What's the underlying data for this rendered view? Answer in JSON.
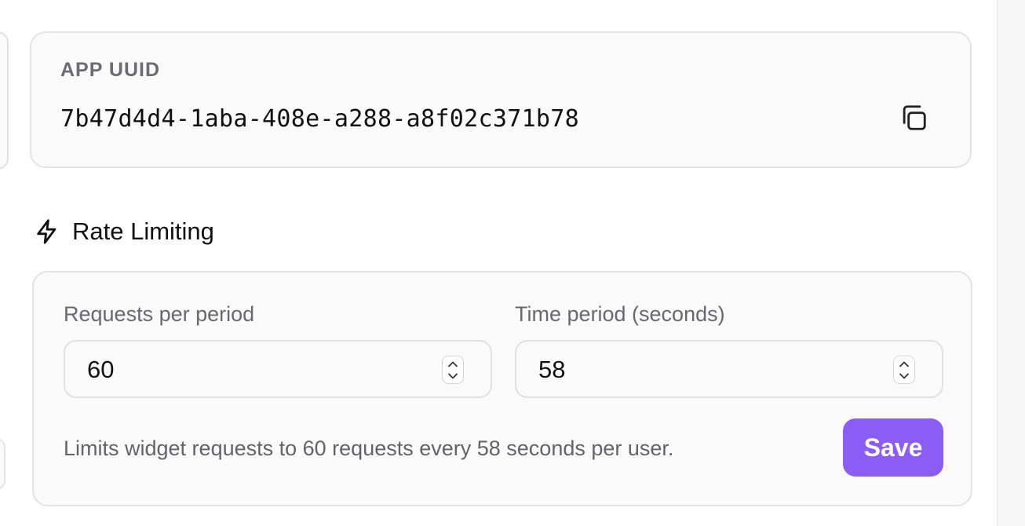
{
  "app_uuid": {
    "label": "APP UUID",
    "value": "7b47d4d4-1aba-408e-a288-a8f02c371b78",
    "copy_icon": "copy-icon"
  },
  "rate_limiting": {
    "title": "Rate Limiting",
    "icon": "lightning-bolt-icon",
    "requests_per_period": {
      "label": "Requests per period",
      "value": "60"
    },
    "time_period": {
      "label": "Time period (seconds)",
      "value": "58"
    },
    "description": "Limits widget requests to 60 requests every 58 seconds per user.",
    "save_label": "Save"
  },
  "colors": {
    "accent": "#8b5cf6",
    "card_background": "#fafafa",
    "border": "#e3e3e5",
    "muted_text": "#68686f"
  }
}
